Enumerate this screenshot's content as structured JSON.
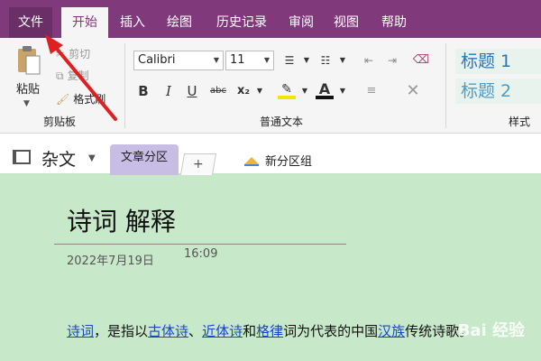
{
  "menu": {
    "file": "文件",
    "tabs": [
      "开始",
      "插入",
      "绘图",
      "历史记录",
      "审阅",
      "视图",
      "帮助"
    ]
  },
  "ribbon": {
    "clipboard": {
      "paste": "粘贴",
      "cut": "剪切",
      "copy": "复制",
      "format_painter": "格式刷",
      "group_label": "剪贴板"
    },
    "text": {
      "font": "Calibri",
      "size": "11",
      "group_label": "普通文本"
    },
    "styles": {
      "heading1": "标题 1",
      "heading2": "标题 2",
      "group_label": "样式"
    }
  },
  "notebook": {
    "name": "杂文",
    "section": "文章分区",
    "add_tab": "+",
    "new_group": "新分区组"
  },
  "page": {
    "title": "诗词 解释",
    "date": "2022年7月19日",
    "time": "16:09",
    "body": {
      "link1": "诗词",
      "text1": "，是指以",
      "link2": "古体诗",
      "text2": "、",
      "link3": "近体诗",
      "text3": "和",
      "link4": "格律",
      "text4": "词为代表的中国",
      "link5": "汉族",
      "text5": "传统诗歌。"
    }
  },
  "watermark": "Bai 经验",
  "colors": {
    "menubar": "#80397b",
    "ribbon": "#f5f5f5",
    "section_tab": "#c8bde4",
    "page_bg": "#c8e8ca",
    "link": "#1a45c8",
    "arrow": "#e02020"
  }
}
